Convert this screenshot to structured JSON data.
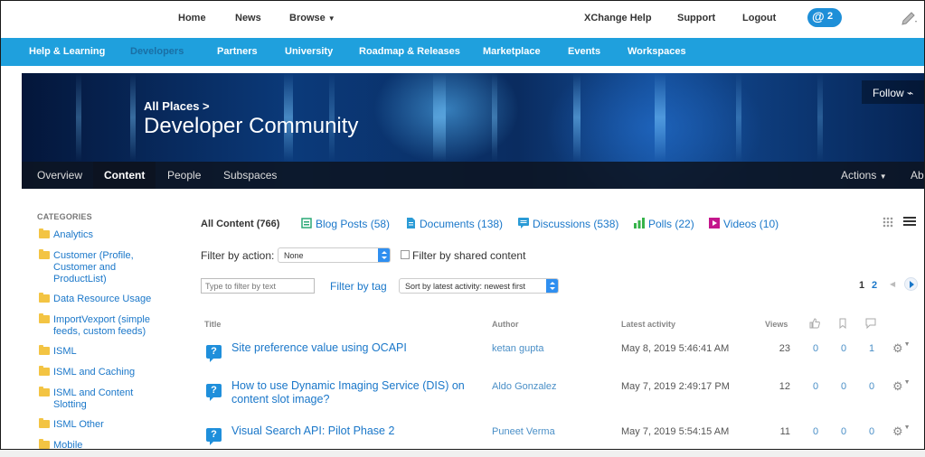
{
  "topnav": {
    "home": "Home",
    "news": "News",
    "browse": "Browse",
    "xchange_help": "XChange Help",
    "support": "Support",
    "logout": "Logout",
    "mentions_count": "2"
  },
  "bluebar": {
    "items": [
      "Help & Learning",
      "Developers",
      "Partners",
      "University",
      "Roadmap & Releases",
      "Marketplace",
      "Events",
      "Workspaces"
    ],
    "active_index": 1
  },
  "banner": {
    "breadcrumb": "All Places >",
    "title": "Developer Community",
    "follow_label": "Follow",
    "tabs": [
      "Overview",
      "Content",
      "People",
      "Subspaces"
    ],
    "active_tab": "Content",
    "actions_label": "Actions",
    "about_label": "Ab"
  },
  "sidebar": {
    "heading": "CATEGORIES",
    "categories": [
      "Analytics",
      "Customer (Profile, Customer and ProductList)",
      "Data Resource Usage",
      "ImportVexport (simple feeds, custom feeds)",
      "ISML",
      "ISML and Caching",
      "ISML and Content Slotting",
      "ISML Other",
      "Mobile"
    ]
  },
  "content_tabs": {
    "all": "All Content (766)",
    "blog_posts": "Blog Posts (58)",
    "documents": "Documents (138)",
    "discussions": "Discussions (538)",
    "polls": "Polls (22)",
    "videos": "Videos (10)"
  },
  "filters": {
    "action_label": "Filter by action:",
    "action_value": "None",
    "shared_label": "Filter by shared content",
    "text_placeholder": "Type to filter by text",
    "tag_label": "Filter by tag",
    "sort_value": "Sort by latest activity: newest first"
  },
  "pagination": {
    "page1": "1",
    "page2": "2"
  },
  "table": {
    "headers": {
      "title": "Title",
      "author": "Author",
      "latest": "Latest activity",
      "views": "Views"
    },
    "rows": [
      {
        "title": "Site preference value using OCAPI",
        "author": "ketan gupta",
        "date": "May 8, 2019 5:46:41 AM",
        "views": "23",
        "likes": "0",
        "bookmarks": "0",
        "replies": "1"
      },
      {
        "title": "How to use Dynamic Imaging Service (DIS) on content slot image?",
        "author": "Aldo Gonzalez",
        "date": "May 7, 2019 2:49:17 PM",
        "views": "12",
        "likes": "0",
        "bookmarks": "0",
        "replies": "0"
      },
      {
        "title": "Visual Search API: Pilot Phase 2",
        "author": "Puneet Verma",
        "date": "May 7, 2019 5:54:15 AM",
        "views": "11",
        "likes": "0",
        "bookmarks": "0",
        "replies": "0"
      }
    ]
  },
  "colors": {
    "link": "#1a77c9",
    "bluebar": "#1fa0dd",
    "badge": "#1e8fd8"
  },
  "icons": [
    "pencil-icon",
    "at-mention-icon",
    "folder-icon",
    "blog-icon",
    "document-icon",
    "discussion-icon",
    "poll-icon",
    "video-icon",
    "grid-view-icon",
    "list-view-icon",
    "question-icon",
    "like-icon",
    "bookmark-icon",
    "comment-icon",
    "gear-icon"
  ]
}
